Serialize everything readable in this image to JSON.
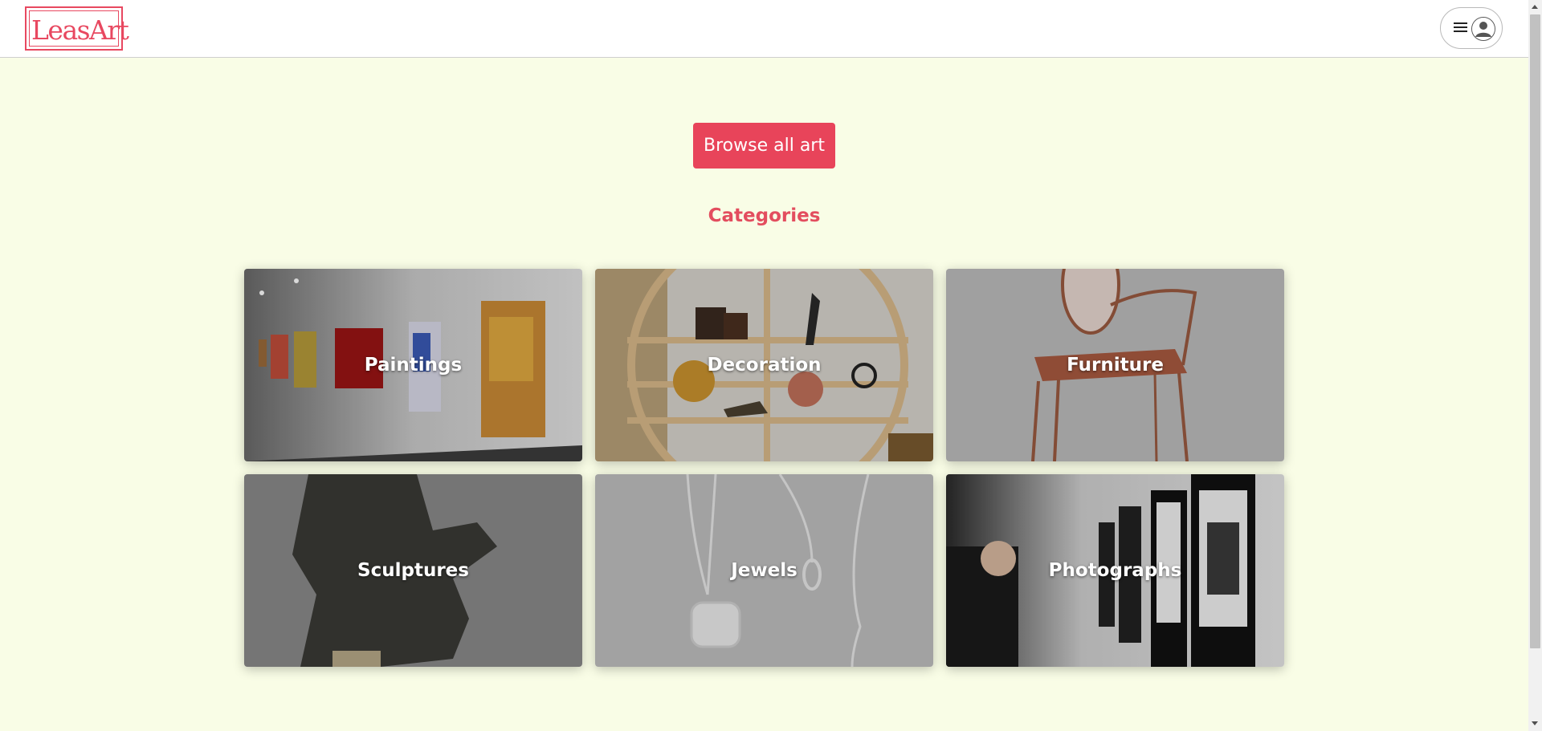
{
  "header": {
    "logo_text": "LeasArt",
    "menu_icon": "hamburger-icon",
    "avatar_icon": "user-avatar-icon"
  },
  "main": {
    "browse_label": "Browse all art",
    "categories_title": "Categories",
    "categories": [
      {
        "label": "Paintings"
      },
      {
        "label": "Decoration"
      },
      {
        "label": "Furniture"
      },
      {
        "label": "Sculptures"
      },
      {
        "label": "Jewels"
      },
      {
        "label": "Photographs"
      }
    ]
  },
  "colors": {
    "accent": "#e8445a",
    "background": "#f9fde6",
    "header_bg": "#ffffff"
  }
}
